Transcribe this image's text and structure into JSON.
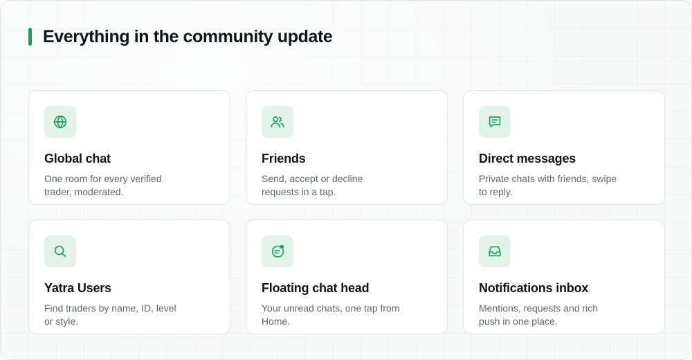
{
  "header": {
    "title": "Everything in the community update"
  },
  "colors": {
    "accent": "#17a35a",
    "icon_bg": "#e3f3e9"
  },
  "features": [
    {
      "icon": "globe-icon",
      "title": "Global chat",
      "description": "One room for every verified trader, moderated."
    },
    {
      "icon": "friends-icon",
      "title": "Friends",
      "description": "Send, accept or decline requests in a tap."
    },
    {
      "icon": "message-icon",
      "title": "Direct messages",
      "description": "Private chats with friends, swipe to reply."
    },
    {
      "icon": "search-icon",
      "title": "Yatra Users",
      "description": "Find traders by name, ID, level or style."
    },
    {
      "icon": "chat-head-icon",
      "title": "Floating chat head",
      "description": "Your unread chats, one tap from Home."
    },
    {
      "icon": "inbox-icon",
      "title": "Notifications inbox",
      "description": "Mentions, requests and rich push in one place."
    }
  ]
}
